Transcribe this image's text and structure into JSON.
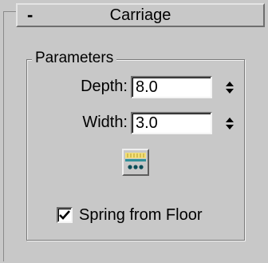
{
  "rollout": {
    "collapse_symbol": "-",
    "title": "Carriage"
  },
  "parameters": {
    "group_label": "Parameters",
    "depth": {
      "label": "Depth:",
      "value": "8.0"
    },
    "width": {
      "label": "Width:",
      "value": "3.0"
    },
    "tool_button_icon": "floor-spring-icon",
    "spring_from_floor": {
      "label": "Spring from Floor",
      "checked": true
    }
  },
  "colors": {
    "panel_bg": "#c8c8c8",
    "icon_yellow": "#f2e07a",
    "icon_teal": "#2f8f98",
    "icon_dots": "#0b4d57"
  }
}
